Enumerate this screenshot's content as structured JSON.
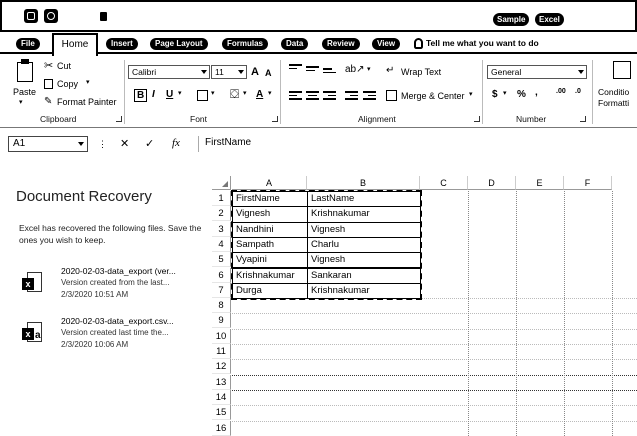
{
  "titlebar": {
    "doc_title": "Sample",
    "app_name": "Excel",
    "save_icon": "save-icon",
    "undo_icon": "undo-icon"
  },
  "tabs": {
    "file": "File",
    "home": "Home",
    "insert": "Insert",
    "page_layout": "Page Layout",
    "formulas": "Formulas",
    "data": "Data",
    "review": "Review",
    "view": "View",
    "tell_me": "Tell me what you want to do"
  },
  "ribbon": {
    "clipboard": {
      "paste": "Paste",
      "cut": "Cut",
      "copy": "Copy",
      "format_painter": "Format Painter",
      "group_label": "Clipboard"
    },
    "font": {
      "name": "Calibri",
      "size": "11",
      "grow": "A",
      "shrink": "A",
      "bold": "B",
      "italic": "I",
      "underline": "U",
      "group_label": "Font"
    },
    "alignment": {
      "wrap_text": "Wrap Text",
      "merge_center": "Merge & Center",
      "group_label": "Alignment"
    },
    "number": {
      "format": "General",
      "currency": "$",
      "percent": "%",
      "comma": ",",
      "increase_decimal": ".00",
      "decrease_decimal": ".0",
      "group_label": "Number"
    },
    "styles": {
      "conditional_1": "Conditio",
      "conditional_2": "Formatti"
    }
  },
  "formula_bar": {
    "name_box": "A1",
    "cancel": "✕",
    "enter": "✓",
    "fx": "fx",
    "value": "FirstName"
  },
  "recovery": {
    "title": "Document Recovery",
    "description": "Excel has recovered the following files. Save the ones you wish to keep.",
    "files": [
      {
        "name": "2020-02-03-data_export (ver...",
        "desc": "Version created from the last...",
        "date": "2/3/2020 10:51 AM"
      },
      {
        "name": "2020-02-03-data_export.csv...",
        "desc": "Version created last time the...",
        "date": "2/3/2020 10:06 AM"
      }
    ]
  },
  "grid": {
    "columns": [
      "A",
      "B",
      "C",
      "D",
      "E",
      "F"
    ],
    "rows": [
      "1",
      "2",
      "3",
      "4",
      "5",
      "6",
      "7",
      "8",
      "9",
      "10",
      "11",
      "12",
      "13",
      "14",
      "15",
      "16"
    ],
    "data": [
      [
        "FirstName",
        "LastName"
      ],
      [
        "Vignesh",
        "Krishnakumar"
      ],
      [
        "Nandhini",
        "Vignesh"
      ],
      [
        "Sampath",
        "Charlu"
      ],
      [
        "Vyapini",
        "Vignesh"
      ],
      [
        "Krishnakumar",
        "Sankaran"
      ],
      [
        "Durga",
        "Krishnakumar"
      ]
    ]
  }
}
